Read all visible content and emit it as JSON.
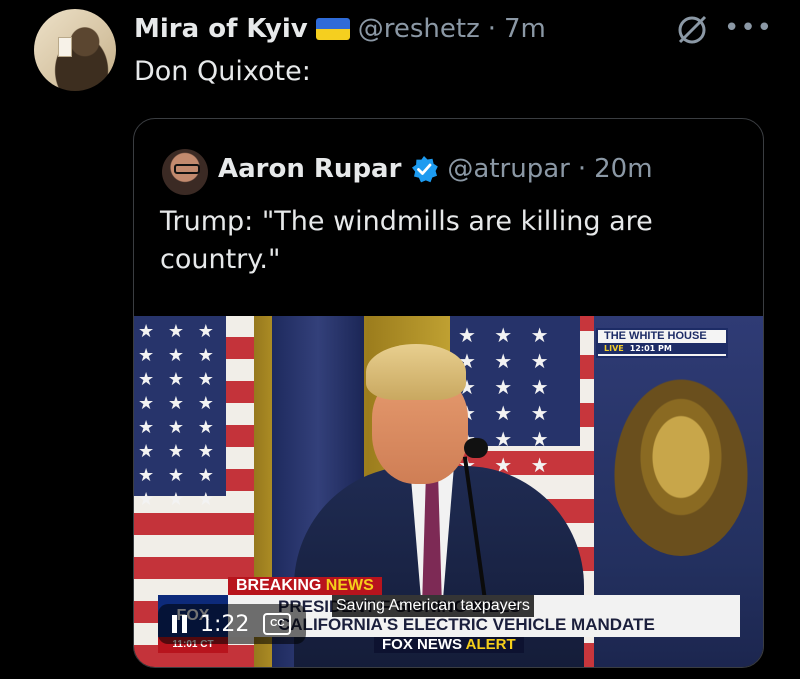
{
  "tweet": {
    "author_name": "Mira of Kyiv",
    "handle": "@reshetz",
    "separator": "·",
    "time": "7m",
    "text": "Don Quixote:"
  },
  "quote": {
    "author_name": "Aaron Rupar",
    "handle": "@atrupar",
    "separator": "·",
    "time": "20m",
    "text": "Trump: \"The windmills are killing are country.\""
  },
  "video": {
    "overlay": {
      "network_logo_top": "THE WHITE HOUSE",
      "live_label": "LIVE",
      "live_time": "12:01 PM",
      "breaking_label": "BREAKING",
      "breaking_news": "NEWS",
      "ticker_line1": "PRESIDENT               F SIGNING BILLS",
      "ticker_line2": "CALIFORNIA'S ELECTRIC VEHICLE MANDATE",
      "fox_news": "FOX NEWS",
      "alert": "ALERT",
      "corner_time": "11:01 CT",
      "fox_logo": "FOX"
    },
    "caption": "Saving American taxpayers",
    "duration": "1:22",
    "cc_label": "CC"
  },
  "colors": {
    "background": "#000000",
    "text": "#e7e9ea",
    "muted": "#8b98a5",
    "verified": "#1d9bf0",
    "border": "#3a3d41"
  }
}
